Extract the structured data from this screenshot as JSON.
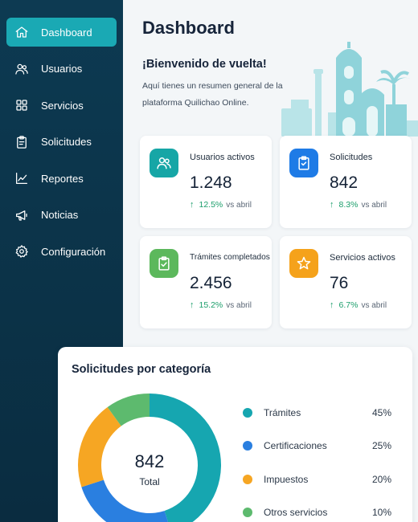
{
  "sidebar": {
    "items": [
      {
        "label": "Dashboard",
        "icon": "home-icon",
        "active": true
      },
      {
        "label": "Usuarios",
        "icon": "users-icon"
      },
      {
        "label": "Servicios",
        "icon": "grid-icon"
      },
      {
        "label": "Solicitudes",
        "icon": "clipboard-icon"
      },
      {
        "label": "Reportes",
        "icon": "chart-icon"
      },
      {
        "label": "Noticias",
        "icon": "megaphone-icon"
      },
      {
        "label": "Configuración",
        "icon": "gear-icon"
      }
    ]
  },
  "header": {
    "title": "Dashboard",
    "welcome": "¡Bienvenido de vuelta!",
    "welcome_sub": "Aquí tienes un resumen general de la plataforma Quilichao Online."
  },
  "stats": [
    {
      "label": "Usuarios activos",
      "value": "1.248",
      "trend": "12.5%",
      "trend_suffix": "vs abril",
      "icon": "users-icon",
      "color": "#16a6a6"
    },
    {
      "label": "Solicitudes",
      "value": "842",
      "trend": "8.3%",
      "trend_suffix": "vs abril",
      "icon": "clipboard-icon",
      "color": "#1e7be6"
    },
    {
      "label": "Trámites completados",
      "value": "2.456",
      "trend": "15.2%",
      "trend_suffix": "vs abril",
      "icon": "clipboard-check-icon",
      "color": "#5cb85c"
    },
    {
      "label": "Servicios activos",
      "value": "76",
      "trend": "6.7%",
      "trend_suffix": "vs abril",
      "icon": "star-icon",
      "color": "#f5a21b"
    }
  ],
  "categories": {
    "title": "Solicitudes por categoría",
    "total_value": "842",
    "total_label": "Total",
    "items": [
      {
        "name": "Trámites",
        "pct": "45%",
        "value": 45,
        "color": "#16a6b0"
      },
      {
        "name": "Certificaciones",
        "pct": "25%",
        "value": 25,
        "color": "#2a7fe0"
      },
      {
        "name": "Impuestos",
        "pct": "20%",
        "value": 20,
        "color": "#f6a623"
      },
      {
        "name": "Otros servicios",
        "pct": "10%",
        "value": 10,
        "color": "#5dba6e"
      }
    ]
  }
}
